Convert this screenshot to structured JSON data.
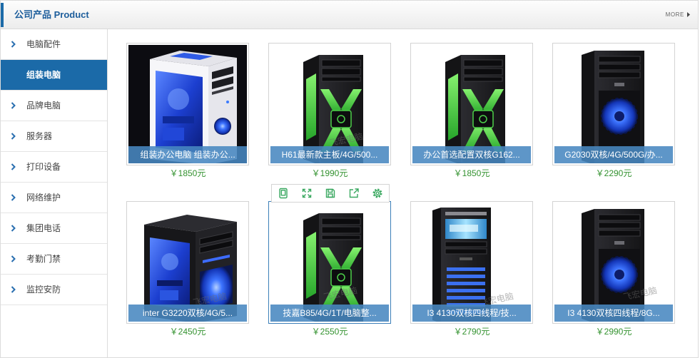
{
  "header": {
    "title": "公司产品 Product",
    "more": "MORE"
  },
  "sidebar": {
    "items": [
      {
        "label": "电脑配件",
        "active": false
      },
      {
        "label": "组装电脑",
        "active": true
      },
      {
        "label": "品牌电脑",
        "active": false
      },
      {
        "label": "服务器",
        "active": false
      },
      {
        "label": "打印设备",
        "active": false
      },
      {
        "label": "网络维护",
        "active": false
      },
      {
        "label": "集团电话",
        "active": false
      },
      {
        "label": "考勤门禁",
        "active": false
      },
      {
        "label": "监控安防",
        "active": false
      }
    ]
  },
  "products": [
    {
      "name": "组装办公电脑 组装办公...",
      "price": "￥1850元"
    },
    {
      "name": "H61最新款主板/4G/500...",
      "price": "￥1990元"
    },
    {
      "name": "办公首选配置双核G162...",
      "price": "￥1850元"
    },
    {
      "name": "G2030双核/4G/500G/办...",
      "price": "￥2290元"
    },
    {
      "name": "inter G3220双核/4G/5...",
      "price": "￥2450元"
    },
    {
      "name": "技嘉B85/4G/1T/电脑整...",
      "price": "￥2550元"
    },
    {
      "name": "I3 4130双核四线程/技...",
      "price": "￥2790元"
    },
    {
      "name": "I3 4130双核四线程/8G...",
      "price": "￥2990元"
    }
  ],
  "watermark": "飞宏电脑",
  "toolbar": {
    "icons": [
      "tablet-icon",
      "expand-icon",
      "save-icon",
      "share-icon",
      "gear-icon"
    ]
  },
  "icons": {
    "sidebar_bullet": "chevron-right-icon",
    "more_arrow": "triangle-right-icon"
  },
  "colors": {
    "accent": "#1b6aa8",
    "title": "#1c5d9b",
    "price": "#33922f",
    "caption": "rgba(72,135,192,0.88)",
    "toolbar_icon": "#3aa860"
  }
}
